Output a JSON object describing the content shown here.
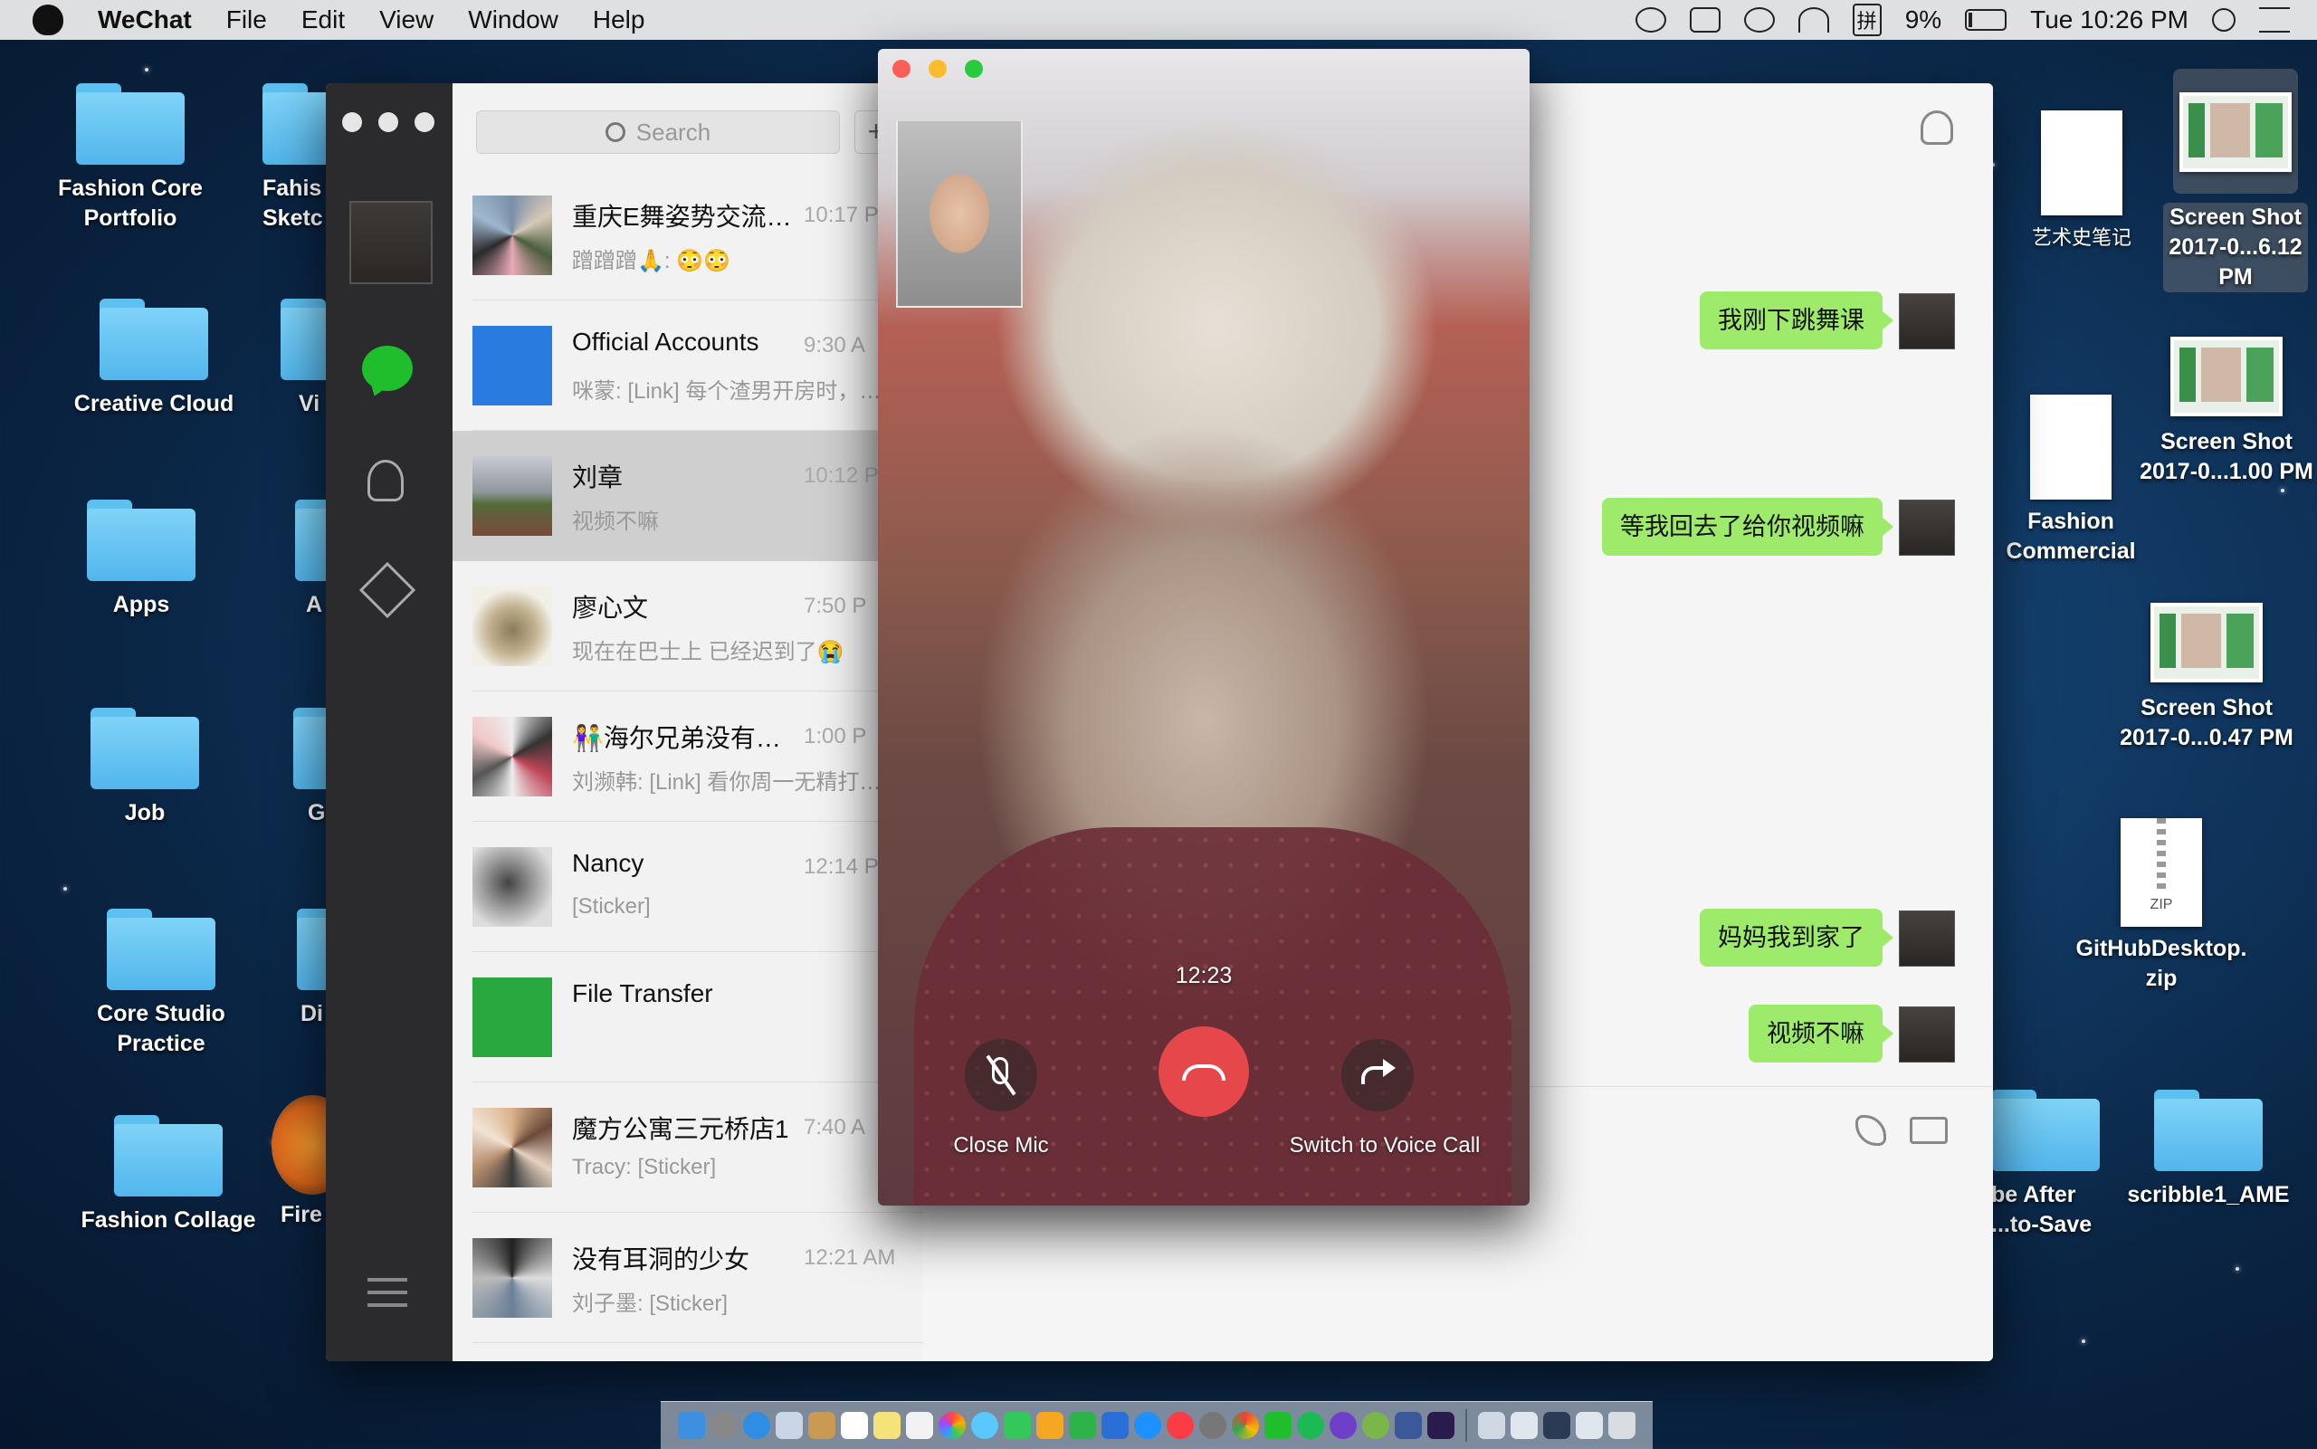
{
  "menubar": {
    "app_name": "WeChat",
    "menus": [
      "File",
      "Edit",
      "View",
      "Window",
      "Help"
    ],
    "ime": "拼",
    "battery": "9%",
    "clock": "Tue 10:26 PM"
  },
  "desktop_left": [
    {
      "label": "Fashion Core Portfolio",
      "type": "folder"
    },
    {
      "label": "Fahis Sketc",
      "type": "folder"
    },
    {
      "label": "Creative Cloud",
      "type": "folder"
    },
    {
      "label": "Vi",
      "type": "folder"
    },
    {
      "label": "Apps",
      "type": "folder"
    },
    {
      "label": "A",
      "type": "folder"
    },
    {
      "label": "Job",
      "type": "folder"
    },
    {
      "label": "G",
      "type": "folder"
    },
    {
      "label": "Core Studio Practice",
      "type": "folder"
    },
    {
      "label": "Di",
      "type": "folder"
    },
    {
      "label": "Fashion Collage",
      "type": "folder"
    },
    {
      "label": "Fire",
      "type": "app"
    }
  ],
  "desktop_right": [
    {
      "label": "艺术史笔记",
      "type": "doc"
    },
    {
      "label": "Screen Shot 2017-0...6.12 PM",
      "type": "thumb"
    },
    {
      "label": "Screen Shot 2017-0...1.00 PM",
      "type": "thumb"
    },
    {
      "label": "Fashion Commercial",
      "type": "doc"
    },
    {
      "label": "Screen Shot 2017-0...0.47 PM",
      "type": "thumb"
    },
    {
      "label": "GitHubDesktop. zip",
      "type": "zip",
      "badge": "ZIP"
    },
    {
      "label": "be After ...to-Save",
      "type": "folder"
    },
    {
      "label": "scribble1_AME",
      "type": "folder"
    }
  ],
  "wechat": {
    "search_placeholder": "Search",
    "add_label": "+",
    "chats": [
      {
        "name": "重庆E舞姿势交流…",
        "time": "10:17 P",
        "preview": "蹭蹭蹭🙏: 😳😳",
        "selected": false
      },
      {
        "name": "Official Accounts",
        "time": "9:30 A",
        "preview": "咪蒙: [Link] 每个渣男开房时，…",
        "selected": false
      },
      {
        "name": "刘章",
        "time": "10:12 P",
        "preview": "视频不嘛",
        "selected": true
      },
      {
        "name": "廖心文",
        "time": "7:50 P",
        "preview": "现在在巴士上 已经迟到了😭",
        "selected": false
      },
      {
        "name": "👫海尔兄弟没有…",
        "time": "1:00 P",
        "preview": "刘濒韩: [Link] 看你周一无精打…",
        "selected": false
      },
      {
        "name": "Nancy",
        "time": "12:14 P",
        "preview": "[Sticker]",
        "selected": false
      },
      {
        "name": "File Transfer",
        "time": "",
        "preview": "",
        "selected": false
      },
      {
        "name": "魔方公寓三元桥店1",
        "time": "7:40 A",
        "preview": "Tracy: [Sticker]",
        "selected": false
      },
      {
        "name": "没有耳洞的少女",
        "time": "12:21 AM",
        "preview": "刘子墨: [Sticker]",
        "selected": false
      }
    ],
    "messages": [
      {
        "text": "我刚下跳舞课"
      },
      {
        "text": "等我回去了给你视频嘛"
      },
      {
        "text": "妈妈我到家了"
      },
      {
        "text": "视频不嘛"
      }
    ]
  },
  "video_call": {
    "duration": "12:23",
    "close_mic_label": "Close Mic",
    "switch_label": "Switch to Voice Call"
  },
  "colors": {
    "wechat_green": "#1fbe2d",
    "bubble_green": "#9eea6a",
    "hangup_red": "#e5474b"
  }
}
